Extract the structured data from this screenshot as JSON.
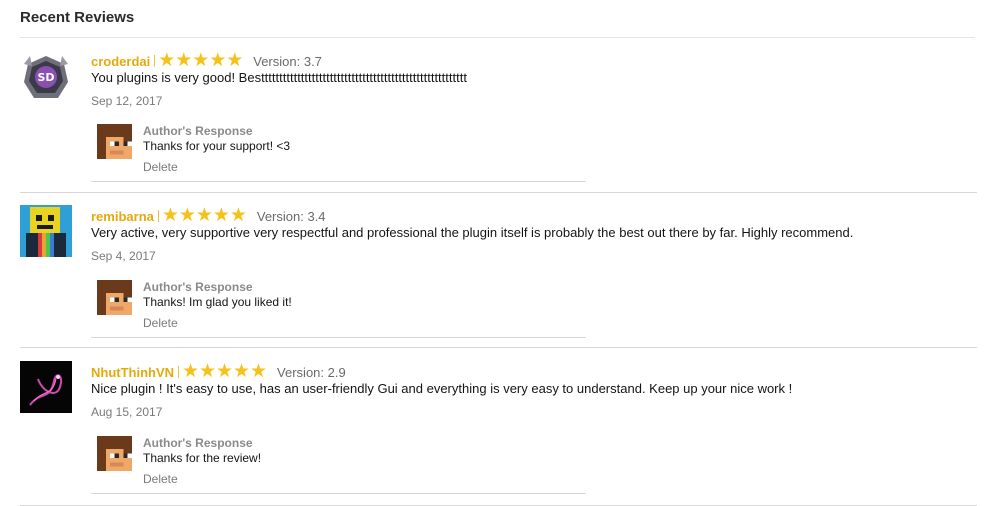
{
  "page_title": "Recent Reviews",
  "reviews": [
    {
      "user": "croderdai",
      "rating": 5,
      "version": "Version: 3.7",
      "text": "You plugins is very good! Besttttttttttttttttttttttttttttttttttttttttttttttttttttttttt",
      "date": "Sep 12, 2017",
      "response": {
        "title": "Author's Response",
        "text": "Thanks for your support! <3",
        "delete": "Delete"
      }
    },
    {
      "user": "remibarna",
      "rating": 5,
      "version": "Version: 3.4",
      "text": "Very active, very supportive very respectful and professional the plugin itself is probably the best out there by far. Highly recommend.",
      "date": "Sep 4, 2017",
      "response": {
        "title": "Author's Response",
        "text": "Thanks! Im glad you liked it!",
        "delete": "Delete"
      }
    },
    {
      "user": "NhutThinhVN",
      "rating": 5,
      "version": "Version: 2.9",
      "text": "Nice plugin ! It's easy to use, has an user-friendly Gui and everything is very easy to understand. Keep up your nice work !",
      "date": "Aug 15, 2017",
      "response": {
        "title": "Author's Response",
        "text": "Thanks for the review!",
        "delete": "Delete"
      }
    }
  ],
  "colors": {
    "username": "#e5a90b",
    "star": "#f5c21b",
    "divider": "#d8d8d8"
  }
}
